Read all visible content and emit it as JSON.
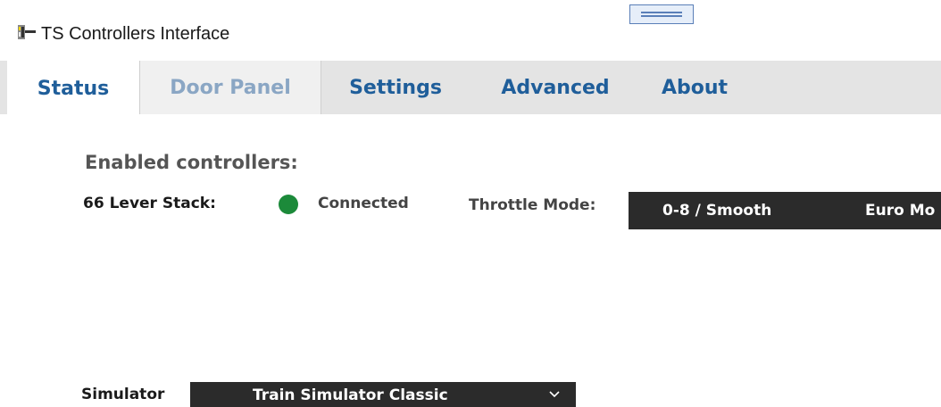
{
  "window": {
    "title": "TS Controllers Interface",
    "icon": "lever-app-icon"
  },
  "tabs": [
    {
      "label": "Status",
      "active": true
    },
    {
      "label": "Door Panel",
      "active": false
    },
    {
      "label": "Settings",
      "active": false
    },
    {
      "label": "Advanced",
      "active": false
    },
    {
      "label": "About",
      "active": false
    }
  ],
  "status": {
    "heading": "Enabled controllers:",
    "controller_name": "66 Lever Stack:",
    "connection_status": "Connected",
    "connection_color": "#1c8a3a",
    "throttle_label": "Throttle Mode:",
    "throttle_options": [
      "0-8 / Smooth",
      "Euro Mo"
    ],
    "simulator_label": "Simulator",
    "simulator_value": "Train Simulator Classic"
  },
  "colors": {
    "tab_text": "#1f5e9a",
    "tab_disabled_text": "#8aa6c4",
    "tabbar_bg": "#e4e4e4",
    "select_bg": "#2b2b2b"
  }
}
